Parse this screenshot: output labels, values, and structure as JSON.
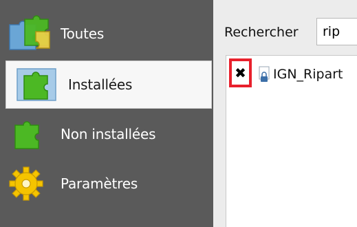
{
  "sidebar": {
    "items": [
      {
        "label": "Toutes",
        "icon": "puzzle-multi-icon",
        "selected": false
      },
      {
        "label": "Installées",
        "icon": "puzzle-installed-icon",
        "selected": true
      },
      {
        "label": "Non installées",
        "icon": "puzzle-not-installed-icon",
        "selected": false
      },
      {
        "label": "Paramètres",
        "icon": "gear-icon",
        "selected": false
      }
    ]
  },
  "search": {
    "label": "Rechercher",
    "value": "rip"
  },
  "plugins": [
    {
      "checkbox_mark": "✖",
      "name": "IGN_Ripart",
      "icon": "plugin-lock-icon"
    }
  ],
  "colors": {
    "sidebar_bg": "#5a5a5a",
    "highlight": "#e8202c",
    "puzzle_green": "#4cb824",
    "puzzle_blue": "#6aa6d6",
    "gear_yellow": "#f5c400"
  }
}
